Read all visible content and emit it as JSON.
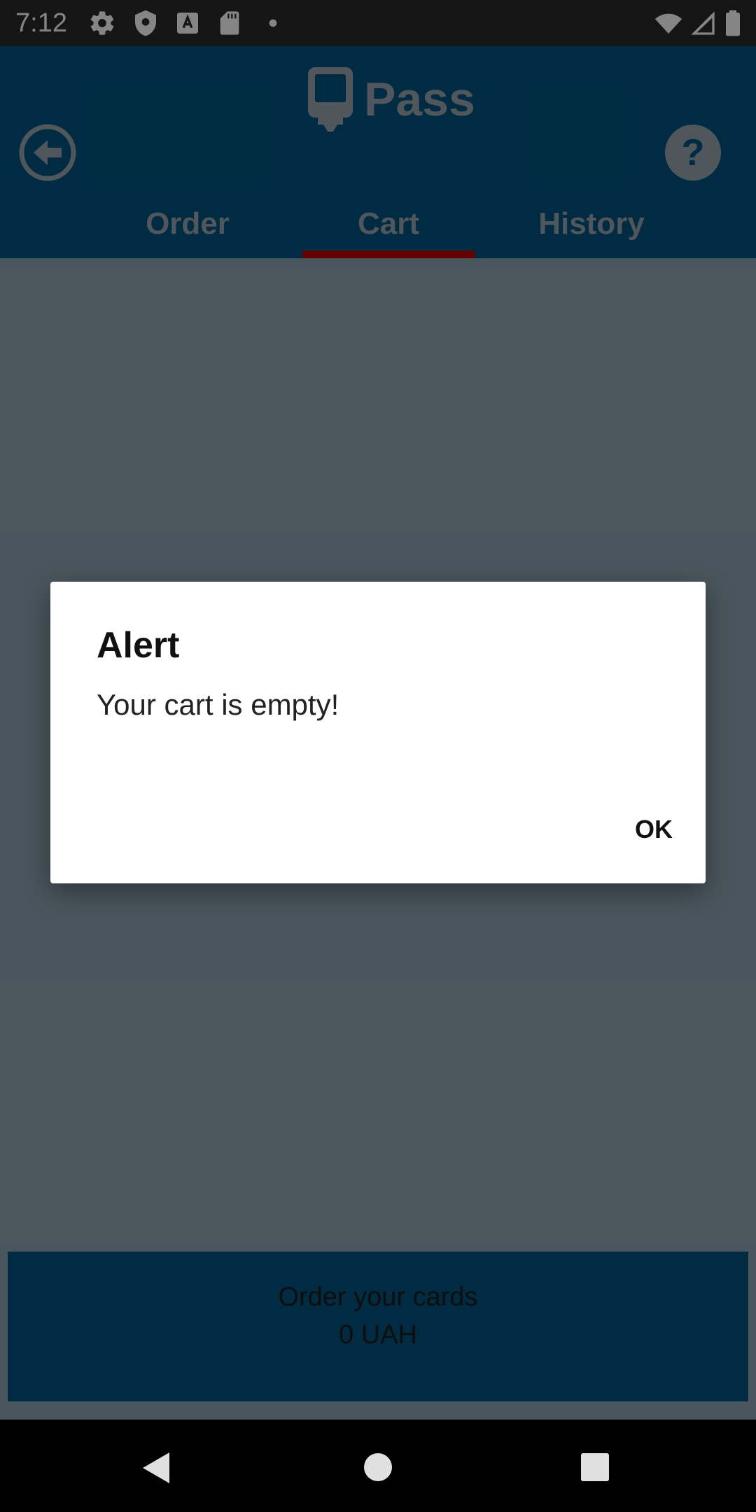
{
  "status_bar": {
    "time": "7:12",
    "left_icons": [
      "gear-icon",
      "shield-icon",
      "text-a-icon",
      "sd-card-icon",
      "dot-icon"
    ],
    "right_icons": [
      "wifi-icon",
      "signal-icon",
      "battery-icon"
    ]
  },
  "header": {
    "logo_text": "Pass",
    "back_icon": "back-arrow-icon",
    "help_icon": "help-icon",
    "tabs": [
      {
        "label": "Order",
        "selected": false
      },
      {
        "label": "Cart",
        "selected": true
      },
      {
        "label": "History",
        "selected": false
      }
    ],
    "indicator_color": "#c20000"
  },
  "order_bar": {
    "line1": "Order your cards",
    "line2": "0 UAH"
  },
  "dialog": {
    "title": "Alert",
    "message": "Your cart is empty!",
    "ok_label": "OK"
  },
  "nav_bar": {
    "icons": [
      "back-triangle-icon",
      "home-circle-icon",
      "recents-square-icon"
    ]
  }
}
